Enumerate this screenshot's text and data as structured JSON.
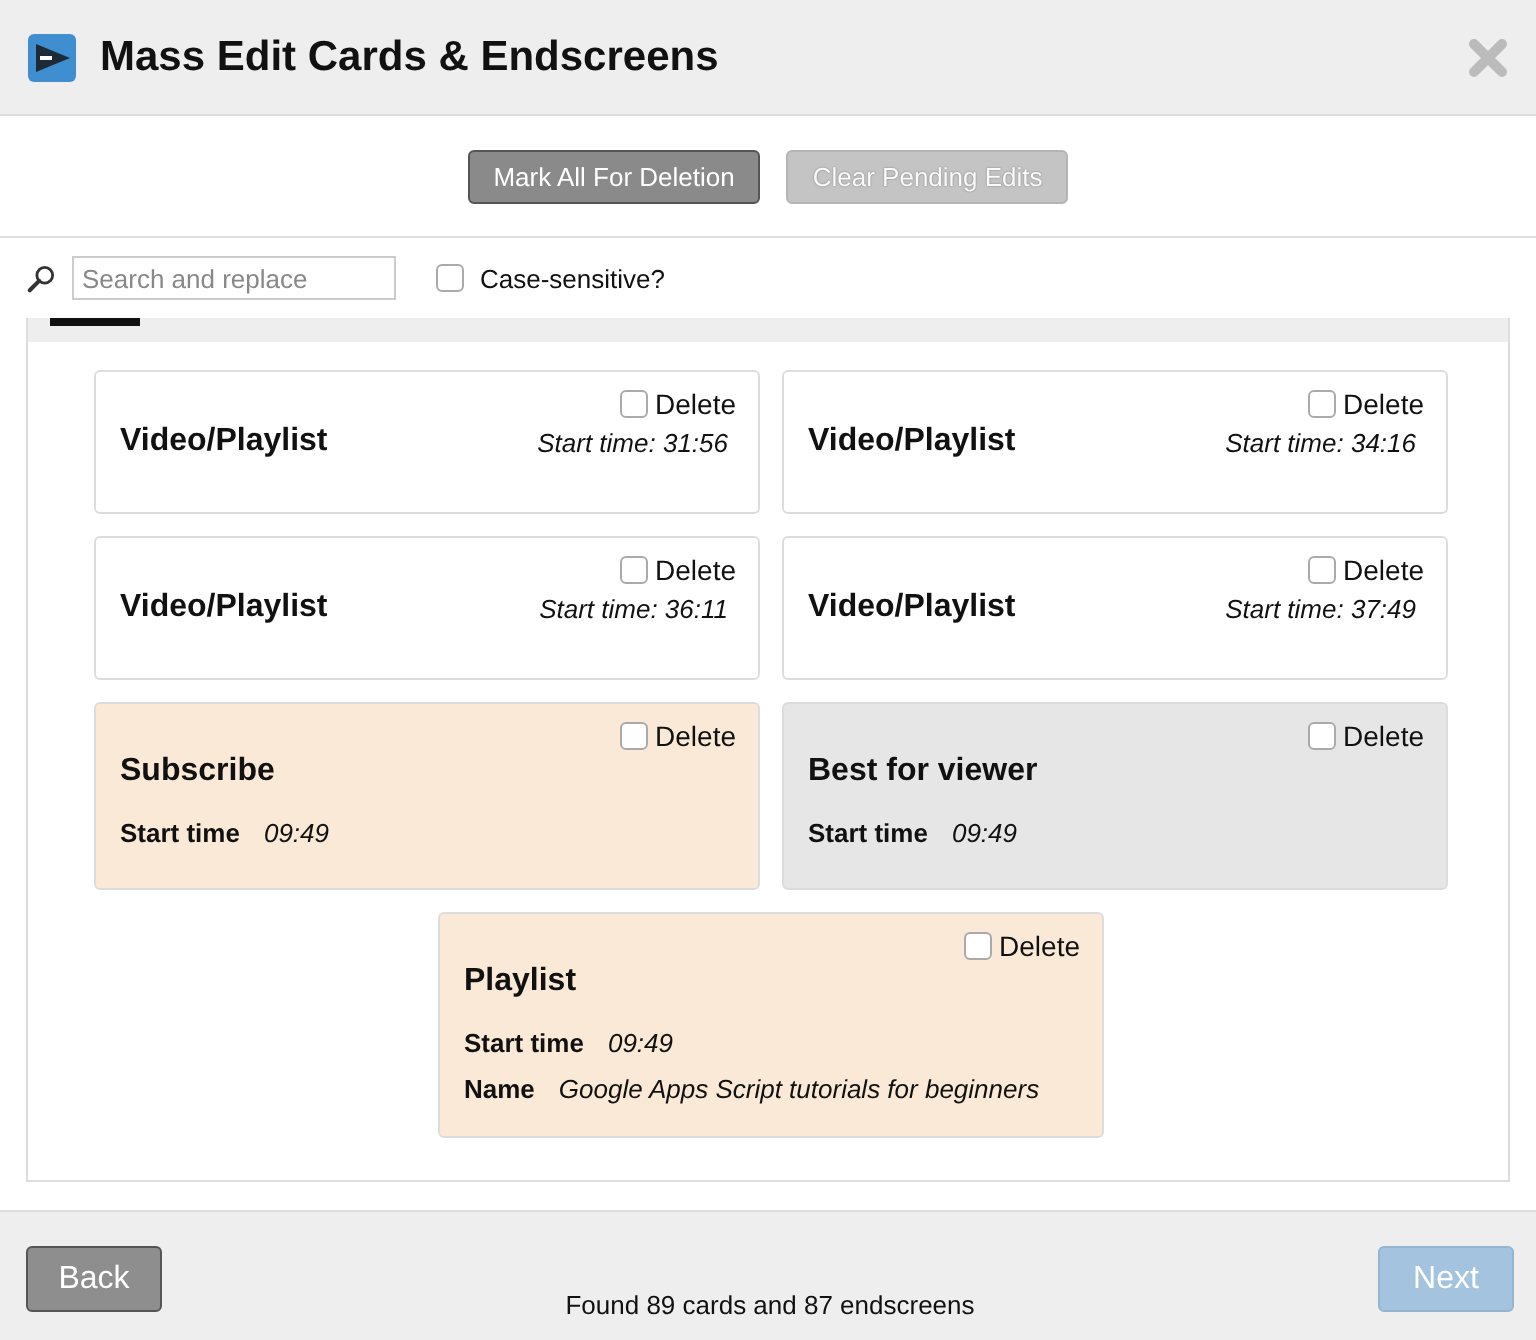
{
  "window": {
    "title": "Mass Edit Cards & Endscreens"
  },
  "toolbar": {
    "buttons": [
      {
        "label": "Mark All For Deletion",
        "disabled": false
      },
      {
        "label": "Clear Pending Edits",
        "disabled": true
      }
    ]
  },
  "search": {
    "placeholder": "Search and replace",
    "case_sensitive": {
      "label": "Case-sensitive?",
      "checked": false
    }
  },
  "cards": [
    {
      "kind": "card",
      "title": "Video/Playlist",
      "start_time": "Start time: 31:56",
      "delete": {
        "label": "Delete",
        "checked": false
      }
    },
    {
      "kind": "card",
      "title": "Video/Playlist",
      "start_time": "Start time: 34:16",
      "delete": {
        "label": "Delete",
        "checked": false
      }
    },
    {
      "kind": "card",
      "title": "Video/Playlist",
      "start_time": "Start time: 36:11",
      "delete": {
        "label": "Delete",
        "checked": false
      }
    },
    {
      "kind": "card",
      "title": "Video/Playlist",
      "start_time": "Start time: 37:49",
      "delete": {
        "label": "Delete",
        "checked": false
      }
    },
    {
      "kind": "endscreen",
      "title": "Subscribe",
      "color": "#f9e9d6",
      "fields": [
        {
          "label": "Start time",
          "value": "09:49"
        }
      ],
      "delete": {
        "label": "Delete",
        "checked": false
      }
    },
    {
      "kind": "endscreen",
      "title": "Best for viewer",
      "color": "#e6e6e6",
      "fields": [
        {
          "label": "Start time",
          "value": "09:49"
        }
      ],
      "delete": {
        "label": "Delete",
        "checked": false
      }
    },
    {
      "kind": "endscreen",
      "title": "Playlist",
      "color": "#f9e9d6",
      "fields": [
        {
          "label": "Start time",
          "value": "09:49"
        },
        {
          "label": "Name",
          "value": "Google Apps Script tutorials for beginners"
        }
      ],
      "delete": {
        "label": "Delete",
        "checked": false
      }
    }
  ],
  "footer": {
    "back": {
      "label": "Back",
      "disabled": false
    },
    "status": "Found 89 cards and 87 endscreens",
    "next": {
      "label": "Next",
      "disabled": true
    }
  }
}
